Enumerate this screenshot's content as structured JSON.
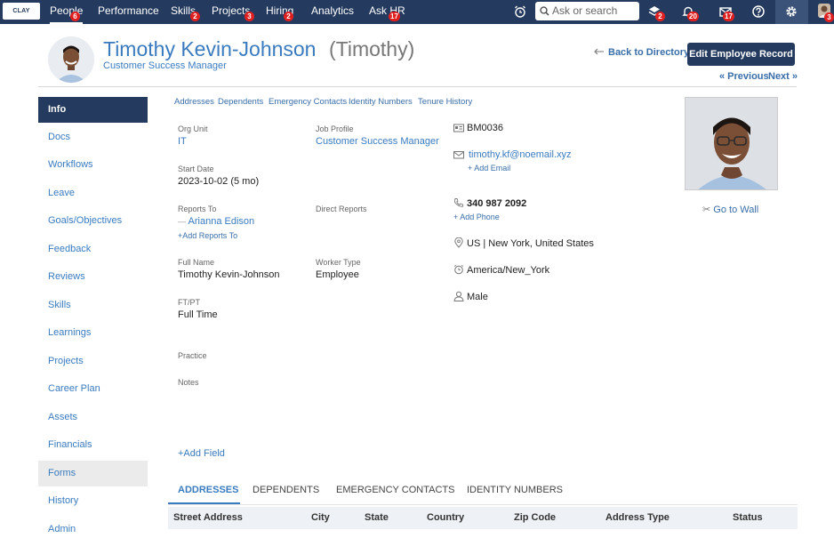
{
  "nav": {
    "logo": "CLAY",
    "items": [
      {
        "label": "People",
        "badge": "6"
      },
      {
        "label": "Performance",
        "badge": ""
      },
      {
        "label": "Skills",
        "badge": "2"
      },
      {
        "label": "Projects",
        "badge": "3"
      },
      {
        "label": "Hiring",
        "badge": "2"
      },
      {
        "label": "Analytics",
        "badge": ""
      },
      {
        "label": "Ask HR",
        "badge": "17"
      }
    ],
    "search_placeholder": "Ask or search",
    "icon_badges": {
      "layers": "2",
      "bell": "20",
      "mail": "17",
      "avatar": "3"
    }
  },
  "header": {
    "name": "Timothy Kevin-Johnson",
    "nickname": "(Timothy)",
    "title": "Customer Success Manager",
    "back_link": "Back to Directory",
    "edit_button": "Edit Employee Record",
    "prev": "« Previous",
    "next": "Next »"
  },
  "sidebar": {
    "items": [
      "Info",
      "Docs",
      "Workflows",
      "Leave",
      "Goals/Objectives",
      "Feedback",
      "Reviews",
      "Skills",
      "Learnings",
      "Projects",
      "Career Plan",
      "Assets",
      "Financials",
      "Forms",
      "History",
      "Admin"
    ]
  },
  "subnav": [
    "Addresses",
    "Dependents",
    "Emergency Contacts",
    "Identity Numbers",
    "Tenure History"
  ],
  "fields": {
    "org_unit": {
      "label": "Org Unit",
      "value": "IT"
    },
    "job_profile": {
      "label": "Job Profile",
      "value": "Customer Success Manager"
    },
    "start_date": {
      "label": "Start Date",
      "value": "2023-10-02 (5 mo)"
    },
    "reports_to": {
      "label": "Reports To",
      "value": "Arianna Edison",
      "add": "+Add Reports To"
    },
    "direct_reports": {
      "label": "Direct Reports"
    },
    "full_name": {
      "label": "Full Name",
      "value": "Timothy Kevin-Johnson"
    },
    "worker_type": {
      "label": "Worker Type",
      "value": "Employee"
    },
    "ftpt": {
      "label": "FT/PT",
      "value": "Full Time"
    },
    "practice": {
      "label": "Practice"
    },
    "notes": {
      "label": "Notes"
    },
    "add_field": "+Add Field"
  },
  "contact": {
    "employee_id": "BM0036",
    "email": "timothy.kf@noemail.xyz",
    "add_email": "+ Add Email",
    "phone": "340 987 2092",
    "add_phone": "+ Add Phone",
    "location": "US | New York, United States",
    "timezone": "America/New_York",
    "gender": "Male"
  },
  "photo": {
    "goto_wall": "Go to Wall"
  },
  "tabs": [
    "ADDRESSES",
    "DEPENDENTS",
    "EMERGENCY CONTACTS",
    "IDENTITY NUMBERS"
  ],
  "table_headers": [
    "Street Address",
    "City",
    "State",
    "Country",
    "Zip Code",
    "Address Type",
    "Status"
  ],
  "colors": {
    "navy": "#243a5e",
    "link": "#3a7bbf",
    "badge": "#e02020"
  }
}
